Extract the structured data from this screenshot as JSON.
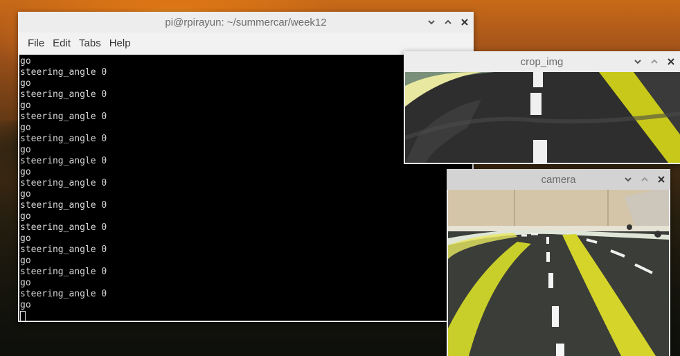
{
  "terminal": {
    "title": "pi@rpirayun: ~/summercar/week12",
    "menu": [
      "File",
      "Edit",
      "Tabs",
      "Help"
    ],
    "lines": [
      "go",
      "steering_angle 0",
      "go",
      "steering_angle 0",
      "go",
      "steering_angle 0",
      "go",
      "steering_angle 0",
      "go",
      "steering_angle 0",
      "go",
      "steering_angle 0",
      "go",
      "steering_angle 0",
      "go",
      "steering_angle 0",
      "go",
      "steering_angle 0",
      "go",
      "steering_angle 0",
      "go",
      "steering_angle 0",
      "go"
    ]
  },
  "crop_window": {
    "title": "crop_img"
  },
  "camera_window": {
    "title": "camera"
  },
  "window_buttons": {
    "minimize": "chevron-down-icon",
    "maximize": "chevron-up-icon",
    "close": "close-icon"
  }
}
